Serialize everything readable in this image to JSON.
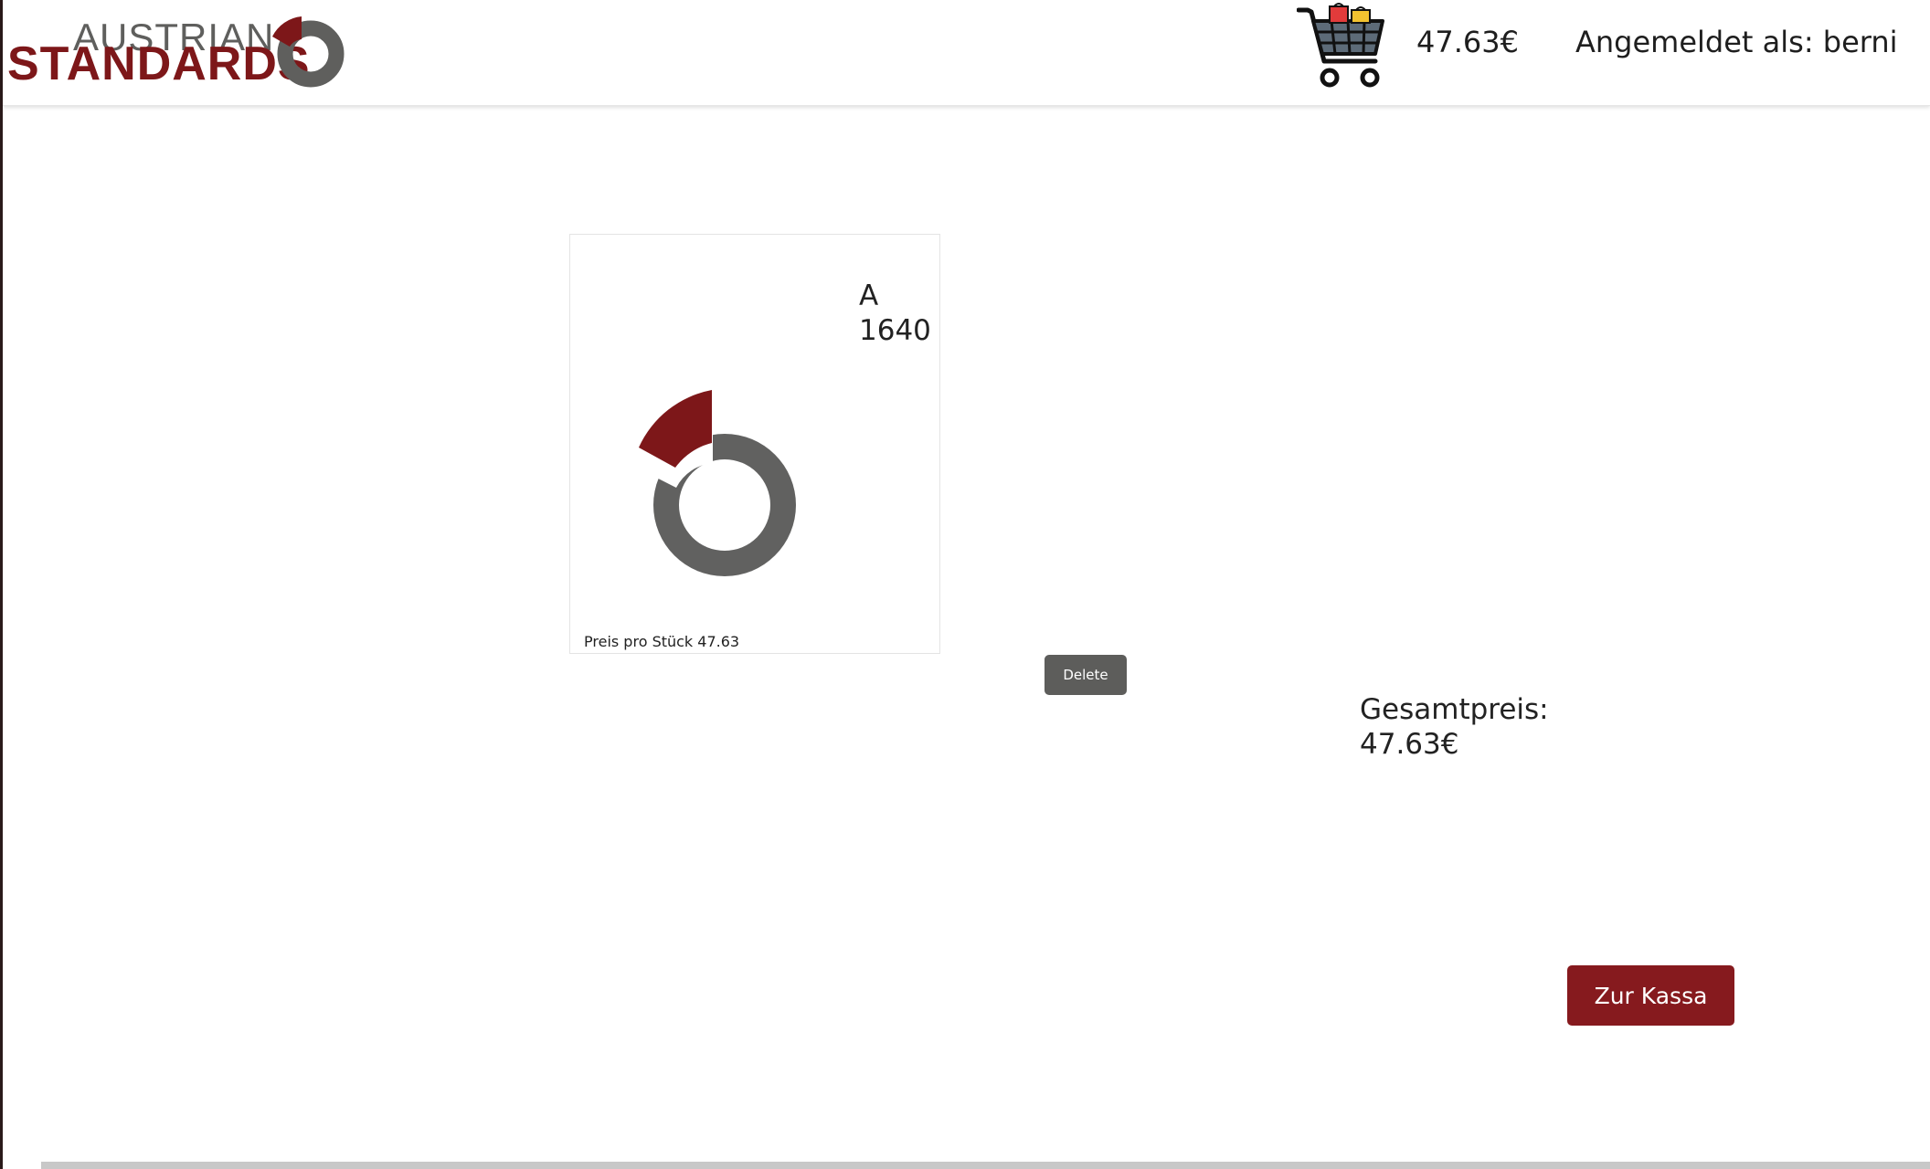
{
  "header": {
    "logo_line1": "AUSTRIAN",
    "logo_line2": "STANDARDS",
    "cart_total": "47.63€",
    "user_label": "Angemeldet als: berni"
  },
  "cart": {
    "items": [
      {
        "title": "A\n1640",
        "price_label": "Preis pro Stück 47.63",
        "delete_label": "Delete"
      }
    ],
    "total_label": "Gesamtpreis:",
    "total_value": "47.63€",
    "checkout_label": "Zur Kassa"
  },
  "icons": {
    "cart": "shopping-cart-icon",
    "logo": "austrian-standards-logo"
  },
  "colors": {
    "brand_red": "#7d1719",
    "brand_gray": "#5f5f5d",
    "delete_button": "#5d5d5b",
    "checkout_button": "#861a1e"
  }
}
